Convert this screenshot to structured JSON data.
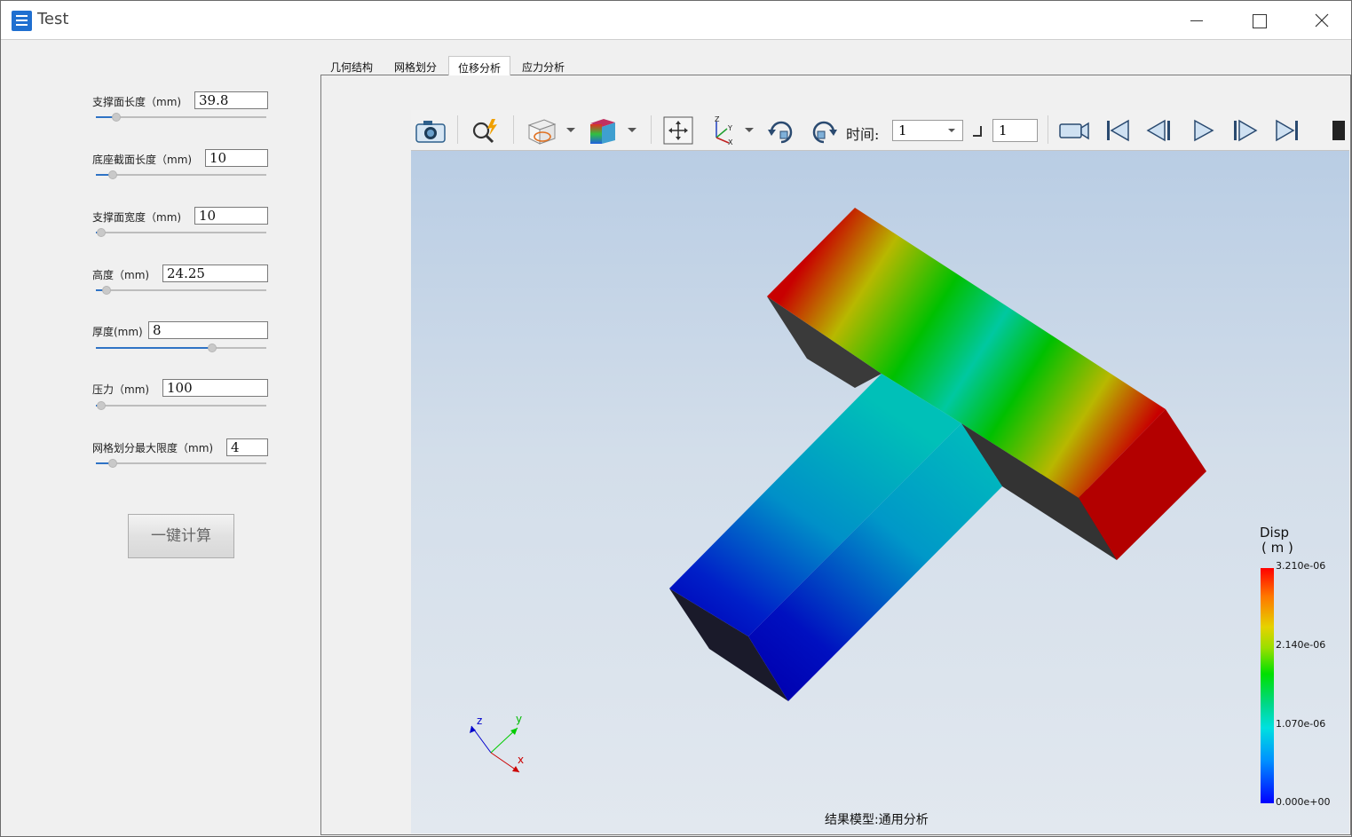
{
  "window": {
    "title": "Test"
  },
  "params": [
    {
      "label": "支撑面长度（mm)",
      "value": "39.8",
      "slider": 0.12
    },
    {
      "label": "底座截面长度（mm)",
      "value": "10",
      "slider": 0.1
    },
    {
      "label": "支撑面宽度（mm)",
      "value": "10",
      "slider": 0.03
    },
    {
      "label": "高度（mm)",
      "value": "24.25",
      "slider": 0.06
    },
    {
      "label": "厚度(mm)",
      "value": "8",
      "slider": 0.68
    },
    {
      "label": "压力（mm)",
      "value": "100",
      "slider": 0.03
    },
    {
      "label": "网格划分最大限度（mm)",
      "value": "4",
      "slider": 0.1
    }
  ],
  "calc_button": "一键计算",
  "tabs": [
    "几何结构",
    "网格划分",
    "位移分析",
    "应力分析"
  ],
  "active_tab": 2,
  "toolbar": {
    "time_label": "时间:",
    "time_value": "1",
    "step_value": "1"
  },
  "legend": {
    "title": "Disp",
    "unit": "( m )",
    "ticks": [
      "3.210e-06",
      "2.140e-06",
      "1.070e-06",
      "0.000e+00"
    ]
  },
  "triad": {
    "x": "x",
    "y": "y",
    "z": "z"
  },
  "footer": "结果模型:通用分析"
}
